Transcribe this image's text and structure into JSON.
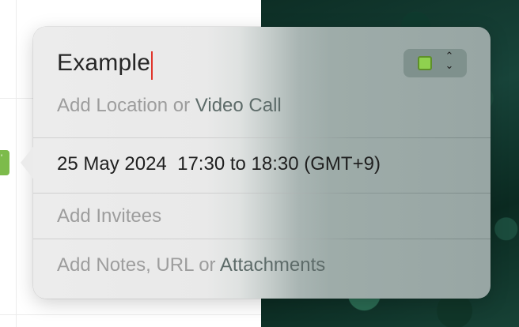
{
  "event_popover": {
    "title": "Example",
    "color": "#8fd14f",
    "location_placeholder_a": "Add Location or ",
    "location_placeholder_b": "Video Call",
    "date": "25 May 2024",
    "start_time": "17:30",
    "to_label": "to",
    "end_time": "18:30",
    "timezone": "(GMT+9)",
    "invitees_placeholder": "Add Invitees",
    "notes_placeholder_a": "Add Notes, URL or ",
    "notes_placeholder_b": "Attachments"
  },
  "colors": {
    "accent_caret": "#e0352b",
    "event_green": "#7dbb4b"
  }
}
